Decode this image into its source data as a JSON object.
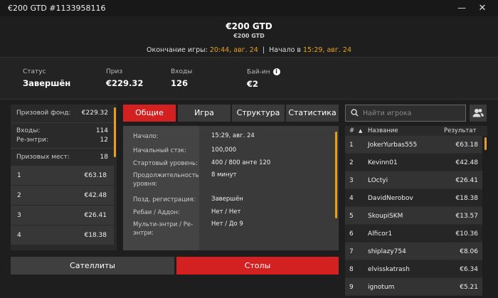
{
  "window": {
    "title": "€200 GTD #1133958116"
  },
  "header": {
    "name": "€200 GTD",
    "subtitle": "€200 GTD",
    "end_label": "Окончание игры:",
    "end_value": "20:44, авг. 24",
    "sep": "|",
    "start_label": "Начало в",
    "start_value": "15:29, авг. 24"
  },
  "summary": [
    {
      "label": "Статус",
      "value": "Завершён"
    },
    {
      "label": "Приз",
      "value": "€229.32"
    },
    {
      "label": "Входы",
      "value": "126"
    },
    {
      "label": "Бай-ин",
      "value": "€2",
      "info": "i"
    }
  ],
  "left_panel": {
    "prize_fund_label": "Призовой фонд:",
    "prize_fund_value": "€229.32",
    "entries_label": "Входы:",
    "entries_value": "114",
    "reentries_label": "Ре-энтри:",
    "reentries_value": "12",
    "places_label": "Призовых мест:",
    "places_value": "18",
    "payouts": [
      {
        "place": "1",
        "amount": "€63.18"
      },
      {
        "place": "2",
        "amount": "€42.48"
      },
      {
        "place": "3",
        "amount": "€26.41"
      },
      {
        "place": "4",
        "amount": "€18.38"
      }
    ]
  },
  "tabs": [
    {
      "label": "Общие",
      "active": true
    },
    {
      "label": "Игра",
      "active": false
    },
    {
      "label": "Структура",
      "active": false
    },
    {
      "label": "Статистика",
      "active": false
    }
  ],
  "details": [
    {
      "key": "Начало:",
      "value": "15:29, авг. 24"
    },
    {
      "key": "Начальный стэк:",
      "value": "100,000"
    },
    {
      "key": "Стартовый уровень:",
      "value": "400 / 800 анте 120"
    },
    {
      "key": "Продолжительность уровня:",
      "value": "8 минут"
    },
    {
      "key": "Позд. регистрация:",
      "value": "Завершён"
    },
    {
      "key": "Ребаи / Аддон:",
      "value": "Нет / Нет"
    },
    {
      "key": "Мульти-энтри / Ре-энтри:",
      "value": "Нет / До 9"
    }
  ],
  "bottom_buttons": {
    "satellites": "Сателлиты",
    "tables": "Столы"
  },
  "search": {
    "placeholder": "Найти игрока"
  },
  "players_table": {
    "col_rank": "#",
    "col_sort": "▲",
    "col_name": "Название",
    "col_result": "Результат",
    "rows": [
      {
        "rank": "1",
        "name": "JokerYurbas555",
        "result": "€63.18"
      },
      {
        "rank": "2",
        "name": "Kevinn01",
        "result": "€42.48"
      },
      {
        "rank": "3",
        "name": "LOctyi",
        "result": "€26.41"
      },
      {
        "rank": "4",
        "name": "DavidNerobov",
        "result": "€18.38"
      },
      {
        "rank": "5",
        "name": "SkoupiSKM",
        "result": "€13.57"
      },
      {
        "rank": "6",
        "name": "Alficor1",
        "result": "€10.36"
      },
      {
        "rank": "7",
        "name": "shiplazy754",
        "result": "€8.06"
      },
      {
        "rank": "8",
        "name": "elvisskatrash",
        "result": "€6.34"
      },
      {
        "rank": "9",
        "name": "ignotum",
        "result": "€5.21"
      }
    ]
  },
  "colors": {
    "accent_red": "#d32020",
    "accent_orange": "#e6a020",
    "background": "#1e1e1e"
  },
  "icons": {
    "close": "close-icon",
    "search": "search-icon",
    "users": "users-icon",
    "minimize": "minimize-icon"
  }
}
